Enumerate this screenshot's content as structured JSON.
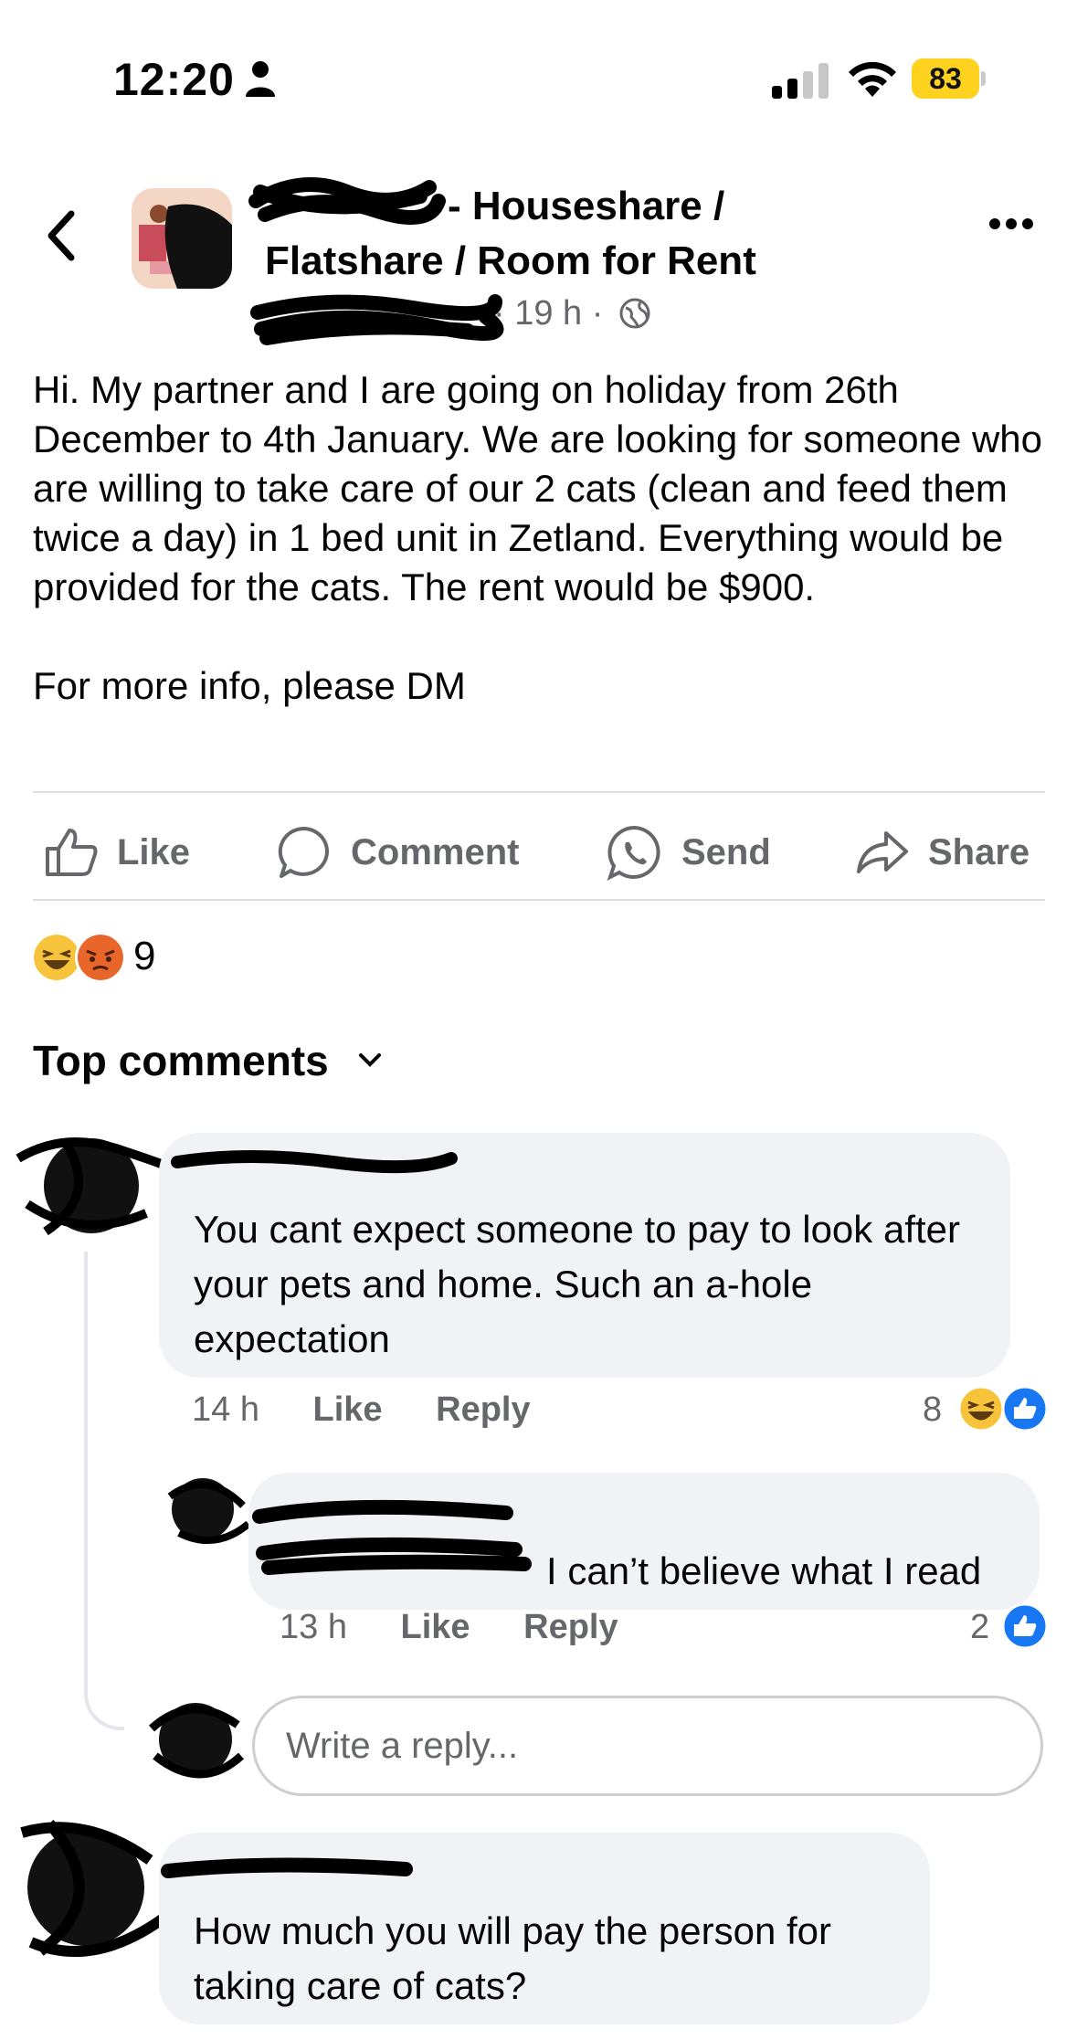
{
  "status_bar": {
    "time": "12:20",
    "battery": "83"
  },
  "header": {
    "group_title": "- Houseshare / Flatshare / Room for Rent",
    "post_meta": "· 19 h ·"
  },
  "post": {
    "text": "Hi. My partner and I are going on holiday from 26th December to 4th January. We are looking for someone who are willing to take care of our 2 cats (clean and feed them twice a day) in 1 bed unit in Zetland. Everything would be provided for the cats. The rent would be $900.\n\nFor more info, please DM"
  },
  "actions": {
    "like": "Like",
    "comment": "Comment",
    "send": "Send",
    "share": "Share"
  },
  "reactions": {
    "count": "9",
    "types": [
      "haha",
      "angry"
    ]
  },
  "comments_header": "Top comments",
  "comments": [
    {
      "text": "You cant expect someone to pay to look after your pets and home. Such an a-hole expectation",
      "time": "14 h",
      "like": "Like",
      "reply": "Reply",
      "reaction_count": "8"
    },
    {
      "text": "I can’t believe what I read",
      "time": "13 h",
      "like": "Like",
      "reply": "Reply",
      "reaction_count": "2"
    },
    {
      "text": "How much you will pay the person for taking care of cats?"
    }
  ],
  "reply_input": {
    "placeholder": "Write a reply..."
  }
}
